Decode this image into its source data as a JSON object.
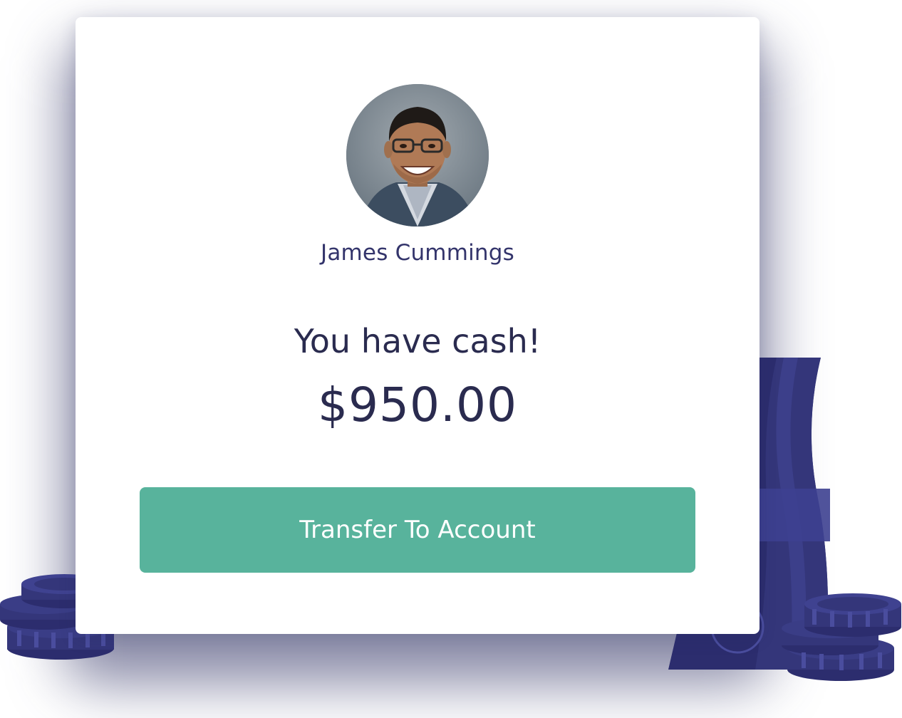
{
  "profile": {
    "name": "James Cummings",
    "avatar_icon": "profile-photo"
  },
  "balance": {
    "headline": "You have cash!",
    "amount": "$950.00"
  },
  "actions": {
    "transfer_label": "Transfer To Account"
  },
  "colors": {
    "accent": "#58b39c",
    "text_primary": "#2a2b4f",
    "name_text": "#33346b",
    "money_illustration": "#34367a"
  }
}
